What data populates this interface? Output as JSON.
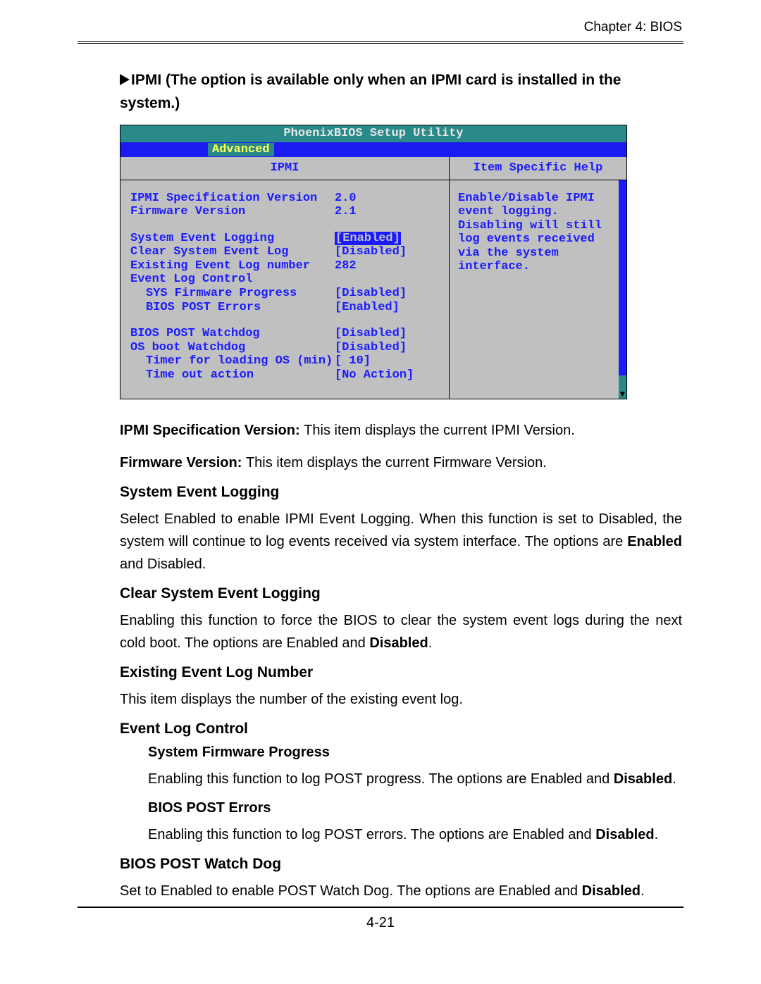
{
  "chapter": "Chapter 4: BIOS",
  "page_number": "4-21",
  "section_heading": "IPMI (The option is available only when an IPMI card is installed in the system.)",
  "bios": {
    "title": "PhoenixBIOS Setup Utility",
    "tab": "Advanced",
    "left_title": "IPMI",
    "right_title": "Item Specific Help",
    "help_text": "Enable/Disable IPMI event logging. Disabling will still log events received via the system interface.",
    "rows": {
      "spec_ver_label": "IPMI Specification Version",
      "spec_ver_val": "2.0",
      "fw_ver_label": "Firmware Version",
      "fw_ver_val": "2.1",
      "sys_evt_label": "System Event Logging",
      "sys_evt_val": "[Enabled]",
      "clear_label": "Clear System Event Log",
      "clear_val": "[Disabled]",
      "exist_label": "Existing Event Log number",
      "exist_val": "282",
      "evt_ctrl_label": "Event Log Control",
      "sys_fw_label": "SYS Firmware Progress",
      "sys_fw_val": "[Disabled]",
      "post_err_label": "BIOS POST Errors",
      "post_err_val": "[Enabled]",
      "post_wd_label": "BIOS POST Watchdog",
      "post_wd_val": "[Disabled]",
      "os_wd_label": "OS boot Watchdog",
      "os_wd_val": "[Disabled]",
      "timer_label": "Timer for loading OS (min)",
      "timer_val": "[ 10]",
      "timeout_label": "Time out action",
      "timeout_val": "[No Action]"
    }
  },
  "body": {
    "ipmi_spec_label": "IPMI Specification Version: ",
    "ipmi_spec_text": "This item displays the current IPMI Version.",
    "fw_label": "Firmware Version: ",
    "fw_text": "This item displays the current Firmware Version.",
    "sys_evt_h": "System Event Logging",
    "sys_evt_p1": "Select Enabled to enable IPMI Event Logging. When this function is set to Disabled, the system will continue to log events received via system interface. The options are ",
    "sys_evt_b": "Enabled",
    "sys_evt_p2": " and Disabled.",
    "clear_h": "Clear System Event Logging",
    "clear_p1": "Enabling this function to force the BIOS to clear the system event logs during the next cold boot. The options are Enabled and ",
    "clear_b": "Disabled",
    "clear_p2": ".",
    "exist_h": "Existing Event Log Number",
    "exist_p": "This item displays the number of the existing event log.",
    "evtctrl_h": "Event Log Control",
    "sfp_h": "System Firmware Progress",
    "sfp_p1": "Enabling this function to log POST progress. The options are Enabled and ",
    "sfp_b": "Disabled",
    "sfp_p2": ".",
    "bpe_h": "BIOS POST Errors",
    "bpe_p1": "Enabling this function to log POST errors. The options are Enabled and ",
    "bpe_b": "Disabled",
    "bpe_p2": ".",
    "bwd_h": "BIOS POST Watch Dog",
    "bwd_p1": "Set to Enabled to enable POST Watch Dog. The options are Enabled and ",
    "bwd_b": "Disabled",
    "bwd_p2": "."
  }
}
